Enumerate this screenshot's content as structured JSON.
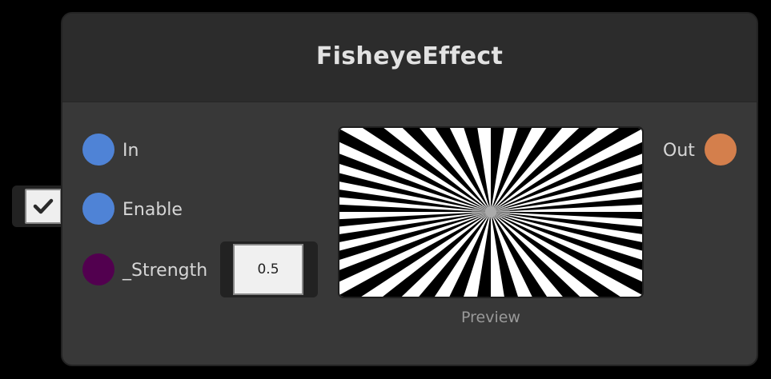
{
  "node": {
    "title": "FisheyeEffect"
  },
  "ports": {
    "inputs": [
      {
        "label": "In",
        "color": "#4f83d6"
      },
      {
        "label": "Enable",
        "color": "#4f83d6"
      },
      {
        "label": "_Strength",
        "color": "#52004f"
      }
    ],
    "output": {
      "label": "Out",
      "color": "#d47f4c"
    }
  },
  "enable_toggle": {
    "checked": true,
    "icon": "checkmark-icon"
  },
  "strength_field": {
    "value": "0.5"
  },
  "preview": {
    "caption": "Preview",
    "pattern": "radial-fisheye-sunburst"
  }
}
